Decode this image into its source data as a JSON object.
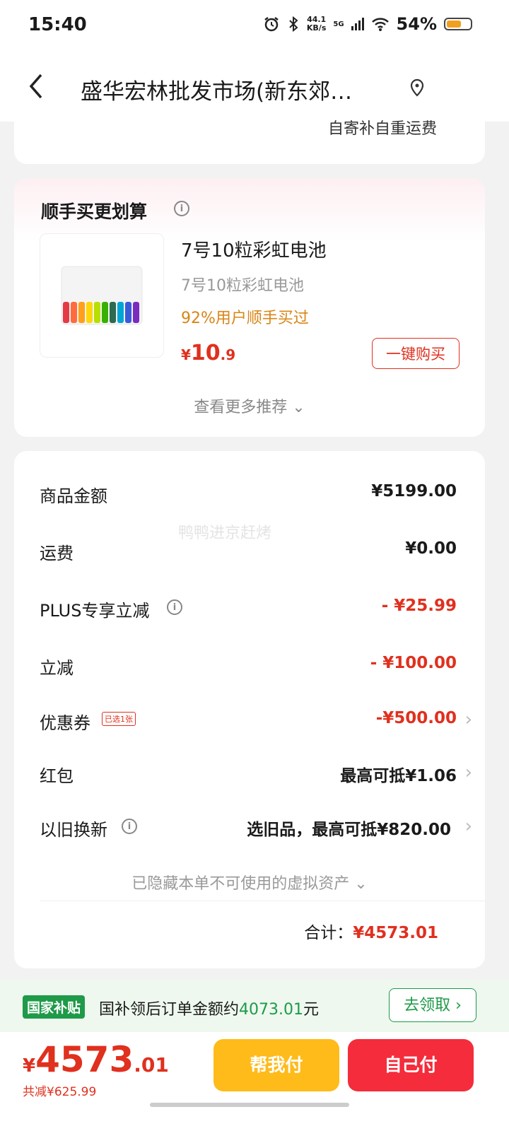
{
  "status_bar": {
    "time": "15:40",
    "net_speed_value": "44.1",
    "net_speed_unit": "KB/s",
    "signal_label": "5G",
    "battery": "54%"
  },
  "header": {
    "title": "盛华宏林批发市场(新东郊…"
  },
  "shipping_note": "自寄补自重运费",
  "recommend": {
    "title": "顺手买更划算",
    "product_name": "7号10粒彩虹电池",
    "product_sub": "7号10粒彩虹电池",
    "tag": "92%用户顺手买过",
    "price_currency": "¥",
    "price_int": "10",
    "price_dec": ".9",
    "buy_label": "一键购买",
    "more_label": "查看更多推荐 ⌄"
  },
  "summary": {
    "watermark": "鸭鸭进京赶烤",
    "rows": [
      {
        "label": "商品金额",
        "value": "¥5199.00"
      },
      {
        "label": "运费",
        "value": "¥0.00"
      },
      {
        "label": "PLUS专享立减",
        "value": "- ¥25.99"
      },
      {
        "label": "立减",
        "value": "- ¥100.00"
      },
      {
        "label": "优惠券",
        "badge": "已选1张",
        "value": "-¥500.00"
      },
      {
        "label": "红包",
        "value": "最高可抵¥1.06"
      },
      {
        "label": "以旧换新",
        "value": "选旧品，最高可抵¥820.00"
      }
    ],
    "hidden_tip": "已隐藏本单不可使用的虚拟资产 ⌄",
    "total_label": "合计：",
    "total_value": "¥4573.01"
  },
  "subsidy": {
    "tag": "国家补贴",
    "text_prefix": "国补领后订单金额约",
    "amount": "4073.01",
    "text_suffix": "元",
    "button": "去领取 ›"
  },
  "bottom": {
    "currency": "¥",
    "price_int": "4573",
    "price_dec": ".01",
    "saved": "共减¥625.99",
    "help_pay": "帮我付",
    "self_pay": "自己付"
  },
  "colors": {
    "accent_red": "#e0301e",
    "green": "#1e9a48",
    "yellow": "#ffbb1a"
  }
}
